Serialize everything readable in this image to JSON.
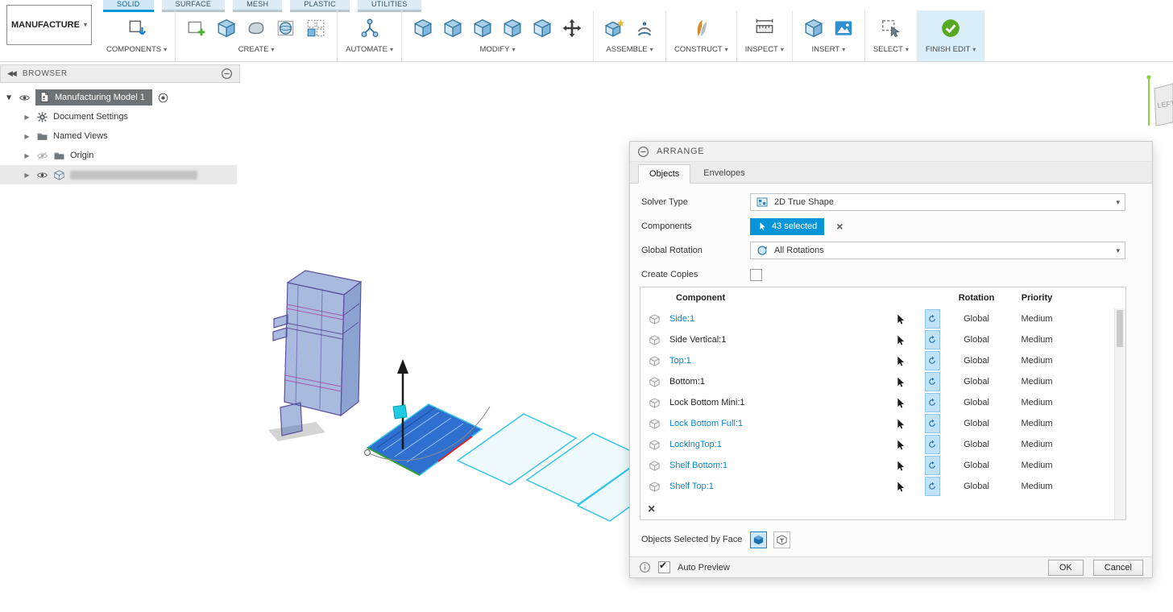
{
  "colors": {
    "accent": "#0696d7",
    "link": "#0a85c7",
    "finish_edit_bg": "#d9eef8",
    "check_green": "#57a721",
    "selection_cyan": "#35c4e8"
  },
  "app": {
    "workspace_label": "MANUFACTURE",
    "tabs": [
      {
        "label": "SOLID",
        "active": true
      },
      {
        "label": "SURFACE",
        "active": false
      },
      {
        "label": "MESH",
        "active": false
      },
      {
        "label": "PLASTIC",
        "active": false
      },
      {
        "label": "UTILITIES",
        "active": false
      }
    ],
    "groups": [
      {
        "label": "COMPONENTS",
        "icons": [
          "component-pattern-icon"
        ],
        "highlight": false
      },
      {
        "label": "CREATE",
        "icons": [
          "create-sketch-icon",
          "box-primitive-icon",
          "form-icon",
          "sphere-primitive-icon",
          "pattern-icon"
        ],
        "highlight": false
      },
      {
        "label": "AUTOMATE",
        "icons": [
          "automate-icon"
        ],
        "highlight": false
      },
      {
        "label": "MODIFY",
        "icons": [
          "press-pull-icon",
          "fillet-icon",
          "shell-icon",
          "combine-icon",
          "split-body-icon",
          "move-copy-icon"
        ],
        "highlight": false
      },
      {
        "label": "ASSEMBLE",
        "icons": [
          "new-component-icon",
          "joint-icon"
        ],
        "highlight": false
      },
      {
        "label": "CONSTRUCT",
        "icons": [
          "construct-plane-icon"
        ],
        "highlight": false
      },
      {
        "label": "INSPECT",
        "icons": [
          "measure-icon"
        ],
        "highlight": false
      },
      {
        "label": "INSERT",
        "icons": [
          "insert-derive-icon",
          "canvas-image-icon"
        ],
        "highlight": false
      },
      {
        "label": "SELECT",
        "icons": [
          "select-window-icon"
        ],
        "highlight": false
      },
      {
        "label": "FINISH EDIT",
        "icons": [
          "finish-edit-check-icon"
        ],
        "highlight": true
      }
    ]
  },
  "browser": {
    "title": "BROWSER",
    "root_label": "Manufacturing Model 1",
    "items": [
      {
        "label": "Document Settings",
        "icon": "gear-icon",
        "eye": "none",
        "redacted": false
      },
      {
        "label": "Named Views",
        "icon": "folder-icon",
        "eye": "none",
        "redacted": false
      },
      {
        "label": "Origin",
        "icon": "folder-icon",
        "eye": "hidden",
        "redacted": false
      },
      {
        "label": "",
        "icon": "bodies-icon",
        "eye": "visible",
        "redacted": true
      }
    ]
  },
  "viewcube": {
    "face_label": "LEFT"
  },
  "dialog": {
    "title": "ARRANGE",
    "tabs": [
      "Objects",
      "Envelopes"
    ],
    "fields": {
      "solver_type_label": "Solver Type",
      "solver_type_value": "2D True Shape",
      "components_label": "Components",
      "components_value": "43 selected",
      "global_rotation_label": "Global Rotation",
      "global_rotation_value": "All Rotations",
      "create_copies_label": "Create Copies",
      "create_copies_checked": false
    },
    "table": {
      "headers": [
        "Component",
        "Rotation",
        "Priority"
      ],
      "rows": [
        {
          "name": "Side:1",
          "link": true,
          "rotation": "Global",
          "priority": "Medium"
        },
        {
          "name": "Side Vertical:1",
          "link": false,
          "rotation": "Global",
          "priority": "Medium"
        },
        {
          "name": "Top:1",
          "link": true,
          "rotation": "Global",
          "priority": "Medium"
        },
        {
          "name": "Bottom:1",
          "link": false,
          "rotation": "Global",
          "priority": "Medium"
        },
        {
          "name": "Lock Bottom Mini:1",
          "link": false,
          "rotation": "Global",
          "priority": "Medium"
        },
        {
          "name": "Lock Bottom Full:1",
          "link": true,
          "rotation": "Global",
          "priority": "Medium"
        },
        {
          "name": "LockingTop:1",
          "link": true,
          "rotation": "Global",
          "priority": "Medium"
        },
        {
          "name": "Shelf Bottom:1",
          "link": true,
          "rotation": "Global",
          "priority": "Medium"
        },
        {
          "name": "Shelf Top:1",
          "link": true,
          "rotation": "Global",
          "priority": "Medium"
        }
      ]
    },
    "objects_by_face_label": "Objects Selected by Face",
    "auto_preview_label": "Auto Preview",
    "auto_preview_checked": true,
    "ok_label": "OK",
    "cancel_label": "Cancel"
  }
}
